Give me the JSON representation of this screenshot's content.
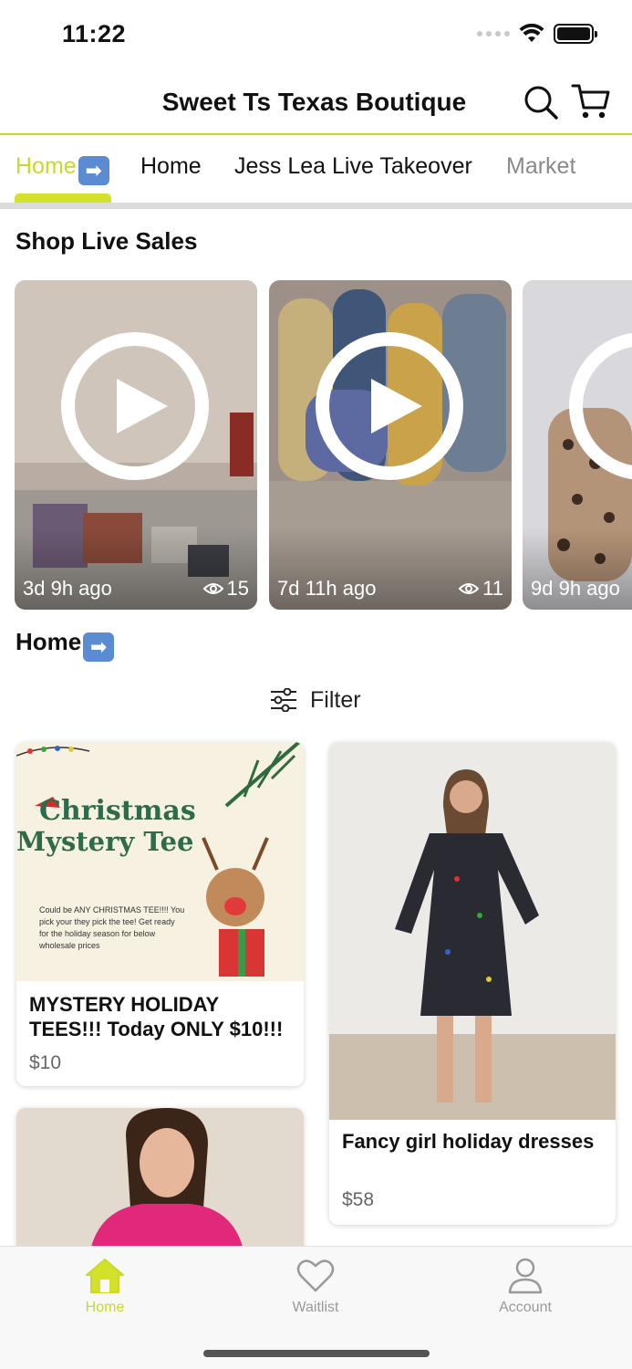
{
  "status_bar": {
    "time": "11:22"
  },
  "header": {
    "title": "Sweet Ts Texas Boutique"
  },
  "tabs": [
    {
      "label": "Home",
      "emoji": "➡"
    },
    {
      "label": "Home"
    },
    {
      "label": "Jess Lea Live Takeover"
    },
    {
      "label": "Market"
    }
  ],
  "live_section": {
    "title": "Shop Live Sales",
    "videos": [
      {
        "ago": "3d 9h ago",
        "views": "15"
      },
      {
        "ago": "7d 11h ago",
        "views": "11"
      },
      {
        "ago": "9d 9h ago",
        "views": ""
      }
    ]
  },
  "home_section": {
    "title": "Home",
    "emoji": "➡"
  },
  "filter": {
    "label": "Filter"
  },
  "products": [
    {
      "name": "MYSTERY HOLIDAY TEES!!! Today ONLY $10!!!",
      "price": "$10",
      "image": {
        "headline_1": "Christmas",
        "headline_2": "Mystery Tee",
        "body": "Could be ANY CHRISTMAS TEE!!!! You pick your they pick the tee! Get ready for the holiday season for below wholesale prices"
      }
    },
    {
      "name": "Fancy girl holiday dresses",
      "price": "$58"
    }
  ],
  "bottom_nav": [
    {
      "label": "Home",
      "icon": "home-icon"
    },
    {
      "label": "Waitlist",
      "icon": "heart-icon"
    },
    {
      "label": "Account",
      "icon": "person-icon"
    }
  ],
  "colors": {
    "accent": "#c8d92a",
    "text": "#111111",
    "muted": "#666666"
  }
}
